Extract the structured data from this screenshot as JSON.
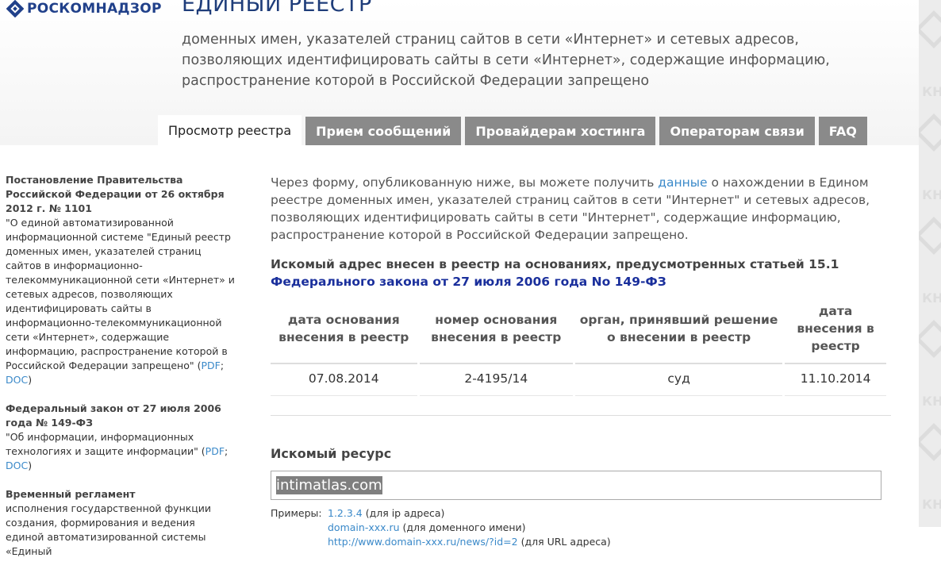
{
  "header": {
    "logo_text": "РОСКОМНАДЗОР",
    "title": "ЕДИНЫЙ РЕЕСТР",
    "subtitle": "доменных имен, указателей страниц сайтов в сети «Интернет» и сетевых адресов, позволяющих идентифицировать сайты в сети «Интернет», содержащие информацию, распространение которой в Российской Федерации запрещено"
  },
  "tabs": [
    {
      "label": "Просмотр реестра",
      "active": true
    },
    {
      "label": "Прием сообщений",
      "active": false
    },
    {
      "label": "Провайдерам хостинга",
      "active": false
    },
    {
      "label": "Операторам связи",
      "active": false
    },
    {
      "label": "FAQ",
      "active": false
    }
  ],
  "sidebar": {
    "docs": [
      {
        "title": "Постановление Правительства Российской Федерации от 26 октября 2012 г. № 1101",
        "desc": "\"О единой автоматизированной информационной системе \"Единый реестр доменных имен, указателей страниц сайтов в информационно-телекоммуникационной сети «Интернет» и сетевых адресов, позволяющих идентифицировать сайты в информационно-телекоммуникационной сети «Интернет», содержащие информацию, распространение которой в Российской Федерации запрещено\" (",
        "link1": "PDF",
        "link2": "DOC",
        "sep": "; ",
        "end": ")"
      },
      {
        "title": "Федеральный закон от 27 июля 2006 года № 149-ФЗ",
        "desc": "\"Об информации, информационных технологиях и защите информации\" (",
        "link1": "PDF",
        "link2": "DOC",
        "sep": "; ",
        "end": ")"
      },
      {
        "title": "Временный регламент",
        "desc": "исполнения государственной функции создания, формирования и ведения единой автоматизированной системы «Единый"
      }
    ]
  },
  "main": {
    "intro_before": "Через форму, опубликованную ниже, вы можете получить ",
    "intro_link": "данные",
    "intro_after": " о нахождении в Едином реестре доменных имен, указателей страниц сайтов в сети \"Интернет\" и сетевых адресов, позволяющих идентифицировать сайты в сети \"Интернет\", содержащие информацию, распространение которой в Российской Федерации запрещено.",
    "basis_text": "Искомый адрес внесен в реестр на основаниях, предусмотренных статьей 15.1 ",
    "basis_link": "Федерального закона от 27 июля 2006 года No 149-ФЗ",
    "table": {
      "headers": [
        "дата основания внесения в реестр",
        "номер основания внесения в реестр",
        "орган, принявший решение о внесении в реестр",
        "дата внесения в реестр"
      ],
      "rows": [
        [
          "07.08.2014",
          "2-4195/14",
          "суд",
          "11.10.2014"
        ]
      ]
    },
    "resource_label": "Искомый ресурс",
    "resource_value": "intimatlas.com",
    "examples_label": "Примеры:",
    "examples": [
      {
        "link": "1.2.3.4",
        "note": " (для ip адреса)"
      },
      {
        "link": "domain-xxx.ru",
        "note": " (для доменного имени)"
      },
      {
        "link": "http://www.domain-xxx.ru/news/?id=2",
        "note": " (для URL адреса)"
      }
    ]
  },
  "watermark": {
    "text": "КН"
  },
  "colors": {
    "brand": "#1f3d7a",
    "link": "#3a89c9",
    "law_link": "#1a2f9c",
    "tab_inactive": "#8a8a8a"
  }
}
